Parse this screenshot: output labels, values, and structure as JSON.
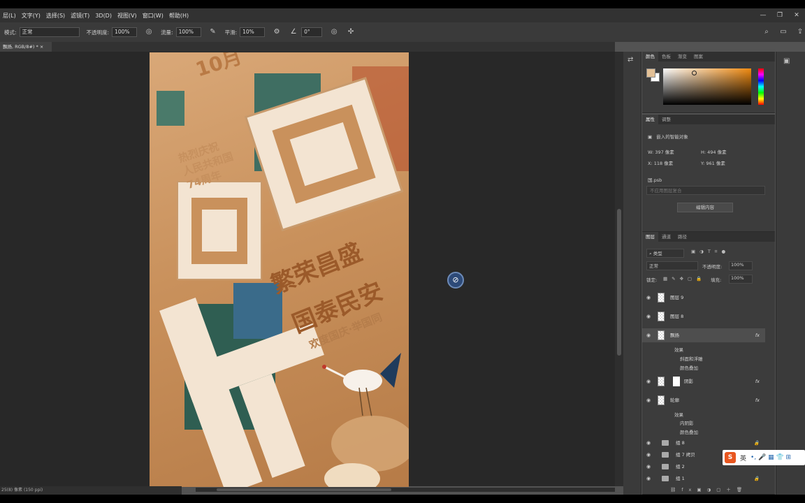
{
  "menu": [
    "层(L)",
    "文字(Y)",
    "选择(S)",
    "滤镜(T)",
    "3D(D)",
    "视图(V)",
    "窗口(W)",
    "帮助(H)"
  ],
  "options": {
    "mode_label": "模式:",
    "mode_value": "正常",
    "opacity_label": "不透明度:",
    "opacity_value": "100%",
    "flow_label": "流量:",
    "flow_value": "100%",
    "smooth_label": "平滑:",
    "smooth_value": "10%",
    "angle_value": "0°"
  },
  "document_tab": "飘扬, RGB/8#) *",
  "status": "25(8) 像素 (150 ppi)",
  "artwork": {
    "big_chars": [
      "国",
      "国",
      "庆"
    ],
    "line1": "繁荣昌盛",
    "line2": "国泰民安",
    "line3": "欢度国庆·举国同",
    "top_text": "10月",
    "celebrate": [
      "热烈庆祝",
      "人民共和国",
      "74周年"
    ]
  },
  "color_panel": {
    "tabs": [
      "颜色",
      "色板",
      "渐变",
      "图案"
    ],
    "fg": "#e3c096",
    "bg": "#ffffff"
  },
  "properties": {
    "tabs": [
      "属性",
      "调整"
    ],
    "type": "嵌入的智能对象",
    "w_label": "W:",
    "w_value": "397 像素",
    "h_label": "H:",
    "h_value": "494 像素",
    "x_label": "X:",
    "x_value": "118 像素",
    "y_label": "Y:",
    "y_value": "961 像素",
    "file": "国.psb",
    "comp": "不应用图层复合",
    "edit_button": "编辑内容"
  },
  "layers_panel": {
    "tabs": [
      "图层",
      "通道",
      "路径"
    ],
    "filter": "类型",
    "blend": "正常",
    "opacity_label": "不透明度:",
    "opacity_value": "100%",
    "lock_label": "锁定:",
    "fill_label": "填充:",
    "fill_value": "100%",
    "layers": [
      {
        "name": "图层 9"
      },
      {
        "name": "图层 8"
      },
      {
        "name": "飘扬",
        "fx": "fx"
      },
      {
        "name": "阴影",
        "fx": "fx"
      },
      {
        "name": "轮廓",
        "fx": "fx"
      }
    ],
    "effects_a": [
      "效果",
      "斜面和浮雕",
      "颜色叠加"
    ],
    "effects_b": [
      "效果",
      "内阴影",
      "颜色叠加"
    ],
    "groups": [
      "组 8",
      "组 7 拷贝",
      "组 2",
      "组 1"
    ]
  },
  "ime": {
    "label": "英"
  }
}
